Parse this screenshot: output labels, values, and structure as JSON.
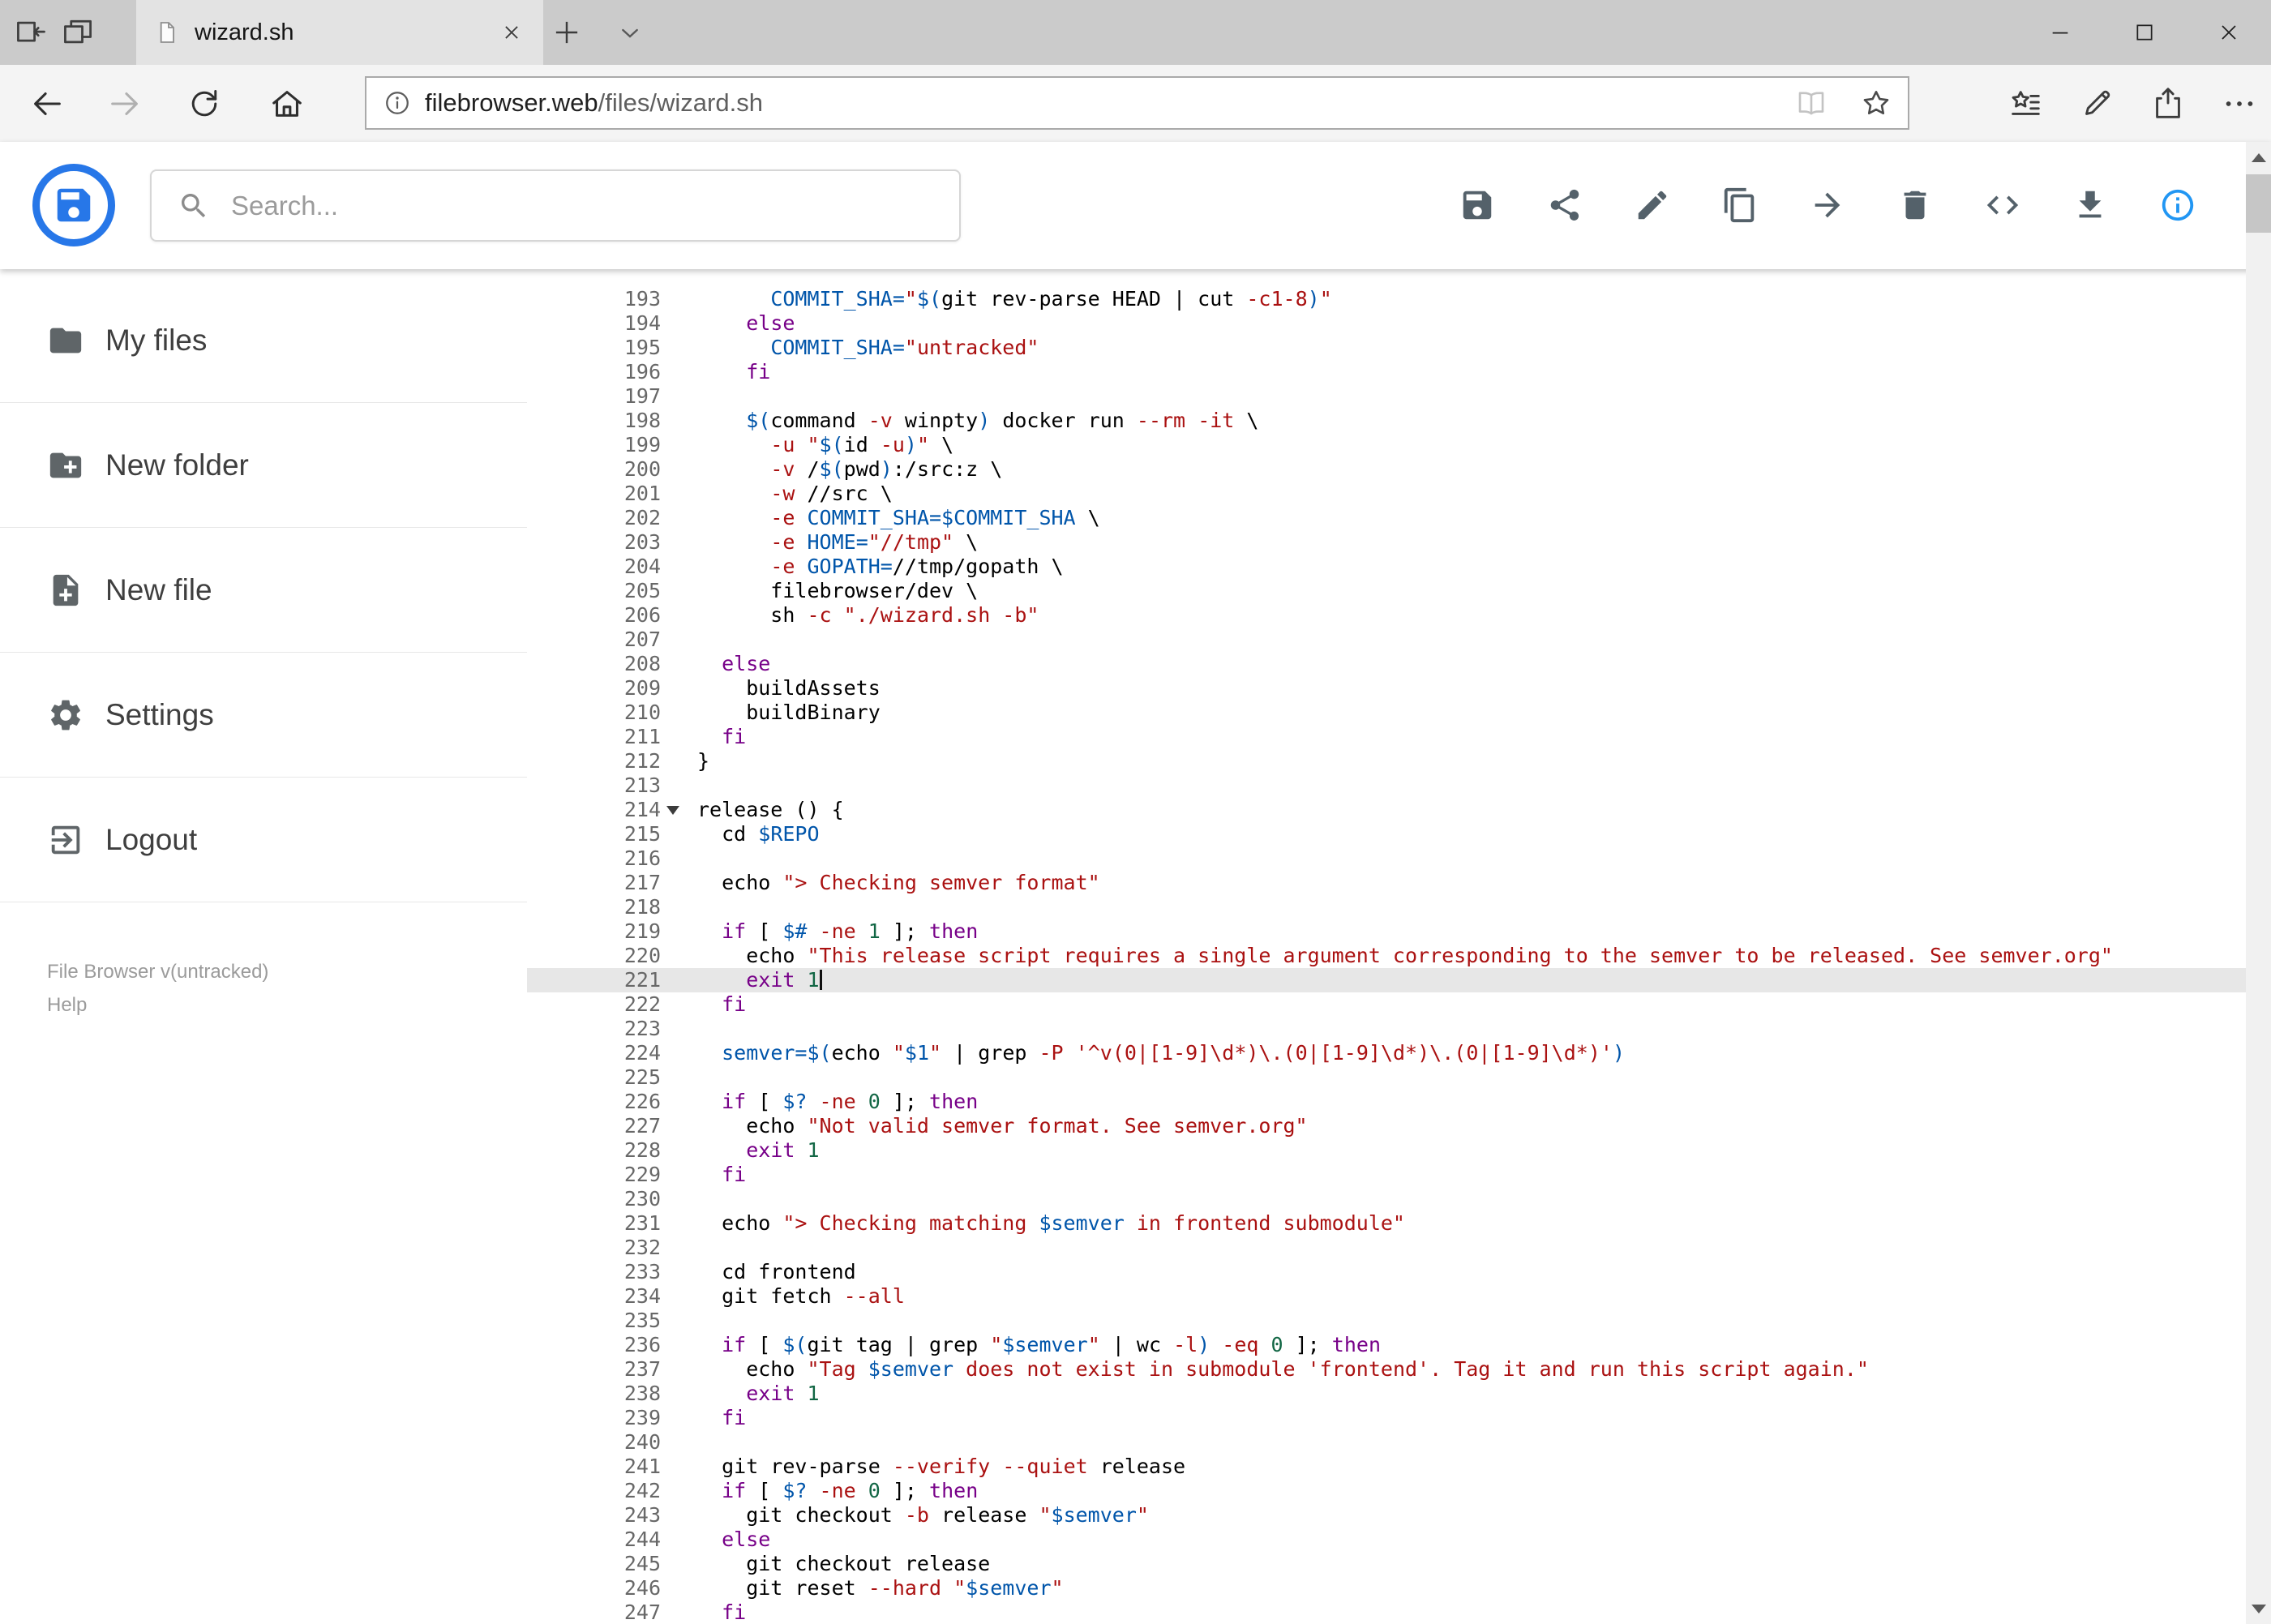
{
  "browser": {
    "tab": {
      "title": "wizard.sh"
    },
    "address": {
      "host": "filebrowser.web",
      "path": "/files/wizard.sh"
    },
    "icons": {
      "tab_strip": [
        "tabs-aside-icon",
        "tab-preview-icon",
        "page-icon",
        "close-tab-icon",
        "new-tab-icon",
        "tab-list-icon"
      ],
      "window_controls": [
        "minimize-icon",
        "maximize-icon",
        "close-window-icon"
      ],
      "navigation": [
        "back-icon",
        "forward-icon",
        "refresh-icon",
        "home-icon"
      ],
      "address_bar": [
        "page-info-icon",
        "reading-view-icon",
        "favorite-star-icon"
      ],
      "actions": [
        "hub-icon",
        "web-note-icon",
        "share-icon",
        "more-icon"
      ]
    }
  },
  "app": {
    "brand_color": "#2777e8",
    "search": {
      "placeholder": "Search..."
    },
    "toolbar_icons": [
      {
        "name": "save-icon",
        "color": "#54616a"
      },
      {
        "name": "share-icon",
        "color": "#54616a"
      },
      {
        "name": "rename-icon",
        "color": "#54616a"
      },
      {
        "name": "copy-icon",
        "color": "#54616a"
      },
      {
        "name": "move-icon",
        "color": "#54616a"
      },
      {
        "name": "delete-icon",
        "color": "#54616a"
      },
      {
        "name": "code-icon",
        "color": "#54616a"
      },
      {
        "name": "download-icon",
        "color": "#54616a"
      },
      {
        "name": "info-icon",
        "color": "#2196f3"
      }
    ],
    "sidebar": {
      "items": [
        {
          "label": "My files",
          "icon": "folder-icon"
        },
        {
          "label": "New folder",
          "icon": "new-folder-icon"
        },
        {
          "label": "New file",
          "icon": "new-file-icon"
        },
        {
          "label": "Settings",
          "icon": "settings-icon"
        },
        {
          "label": "Logout",
          "icon": "logout-icon"
        }
      ],
      "footer": {
        "version": "File Browser v(untracked)",
        "help": "Help"
      }
    }
  },
  "editor": {
    "first_line": 193,
    "last_line": 247,
    "active_line": 221,
    "cursor_line": 221,
    "fold_marker_line": 214,
    "syntax_colors": {
      "plain": "#000000",
      "keyword": "#770088",
      "string": "#aa1111",
      "variable": "#0055aa",
      "number": "#116644",
      "flag": "#aa1111"
    },
    "lines": [
      {
        "n": 193,
        "t": [
          [
            "t",
            "      "
          ],
          [
            "v",
            "COMMIT_SHA="
          ],
          [
            "s",
            "\""
          ],
          [
            "v",
            "$("
          ],
          [
            "t",
            "git rev-parse HEAD | cut "
          ],
          [
            "a",
            "-c1-8"
          ],
          [
            "v",
            ")"
          ],
          [
            "s",
            "\""
          ]
        ]
      },
      {
        "n": 194,
        "t": [
          [
            "t",
            "    "
          ],
          [
            "k",
            "else"
          ]
        ]
      },
      {
        "n": 195,
        "t": [
          [
            "t",
            "      "
          ],
          [
            "v",
            "COMMIT_SHA="
          ],
          [
            "s",
            "\"untracked\""
          ]
        ]
      },
      {
        "n": 196,
        "t": [
          [
            "t",
            "    "
          ],
          [
            "k",
            "fi"
          ]
        ]
      },
      {
        "n": 197,
        "t": []
      },
      {
        "n": 198,
        "t": [
          [
            "t",
            "    "
          ],
          [
            "v",
            "$("
          ],
          [
            "t",
            "command "
          ],
          [
            "a",
            "-v"
          ],
          [
            "t",
            " winpty"
          ],
          [
            "v",
            ")"
          ],
          [
            "t",
            " docker run "
          ],
          [
            "a",
            "--rm"
          ],
          [
            "t",
            " "
          ],
          [
            "a",
            "-it"
          ],
          [
            "t",
            " \\"
          ]
        ]
      },
      {
        "n": 199,
        "t": [
          [
            "t",
            "      "
          ],
          [
            "a",
            "-u"
          ],
          [
            "t",
            " "
          ],
          [
            "s",
            "\""
          ],
          [
            "v",
            "$("
          ],
          [
            "t",
            "id "
          ],
          [
            "a",
            "-u"
          ],
          [
            "v",
            ")"
          ],
          [
            "s",
            "\""
          ],
          [
            "t",
            " \\"
          ]
        ]
      },
      {
        "n": 200,
        "t": [
          [
            "t",
            "      "
          ],
          [
            "a",
            "-v"
          ],
          [
            "t",
            " /"
          ],
          [
            "v",
            "$("
          ],
          [
            "t",
            "pwd"
          ],
          [
            "v",
            ")"
          ],
          [
            "t",
            ":/src:z \\"
          ]
        ]
      },
      {
        "n": 201,
        "t": [
          [
            "t",
            "      "
          ],
          [
            "a",
            "-w"
          ],
          [
            "t",
            " //src \\"
          ]
        ]
      },
      {
        "n": 202,
        "t": [
          [
            "t",
            "      "
          ],
          [
            "a",
            "-e"
          ],
          [
            "t",
            " "
          ],
          [
            "v",
            "COMMIT_SHA=$COMMIT_SHA"
          ],
          [
            "t",
            " \\"
          ]
        ]
      },
      {
        "n": 203,
        "t": [
          [
            "t",
            "      "
          ],
          [
            "a",
            "-e"
          ],
          [
            "t",
            " "
          ],
          [
            "v",
            "HOME="
          ],
          [
            "s",
            "\"//tmp\""
          ],
          [
            "t",
            " \\"
          ]
        ]
      },
      {
        "n": 204,
        "t": [
          [
            "t",
            "      "
          ],
          [
            "a",
            "-e"
          ],
          [
            "t",
            " "
          ],
          [
            "v",
            "GOPATH="
          ],
          [
            "t",
            "//tmp/gopath \\"
          ]
        ]
      },
      {
        "n": 205,
        "t": [
          [
            "t",
            "      filebrowser/dev \\"
          ]
        ]
      },
      {
        "n": 206,
        "t": [
          [
            "t",
            "      sh "
          ],
          [
            "a",
            "-c"
          ],
          [
            "t",
            " "
          ],
          [
            "s",
            "\"./wizard.sh -b\""
          ]
        ]
      },
      {
        "n": 207,
        "t": []
      },
      {
        "n": 208,
        "t": [
          [
            "t",
            "  "
          ],
          [
            "k",
            "else"
          ]
        ]
      },
      {
        "n": 209,
        "t": [
          [
            "t",
            "    buildAssets"
          ]
        ]
      },
      {
        "n": 210,
        "t": [
          [
            "t",
            "    buildBinary"
          ]
        ]
      },
      {
        "n": 211,
        "t": [
          [
            "t",
            "  "
          ],
          [
            "k",
            "fi"
          ]
        ]
      },
      {
        "n": 212,
        "t": [
          [
            "t",
            "}"
          ]
        ]
      },
      {
        "n": 213,
        "t": []
      },
      {
        "n": 214,
        "t": [
          [
            "t",
            "release () {"
          ]
        ]
      },
      {
        "n": 215,
        "t": [
          [
            "t",
            "  cd "
          ],
          [
            "v",
            "$REPO"
          ]
        ]
      },
      {
        "n": 216,
        "t": []
      },
      {
        "n": 217,
        "t": [
          [
            "t",
            "  echo "
          ],
          [
            "s",
            "\"> Checking semver format\""
          ]
        ]
      },
      {
        "n": 218,
        "t": []
      },
      {
        "n": 219,
        "t": [
          [
            "t",
            "  "
          ],
          [
            "k",
            "if"
          ],
          [
            "t",
            " [ "
          ],
          [
            "v",
            "$#"
          ],
          [
            "t",
            " "
          ],
          [
            "a",
            "-ne"
          ],
          [
            "t",
            " "
          ],
          [
            "n",
            "1"
          ],
          [
            "t",
            " ]; "
          ],
          [
            "k",
            "then"
          ]
        ]
      },
      {
        "n": 220,
        "t": [
          [
            "t",
            "    echo "
          ],
          [
            "s",
            "\"This release script requires a single argument corresponding to the semver to be released. See semver.org\""
          ]
        ]
      },
      {
        "n": 221,
        "t": [
          [
            "t",
            "    "
          ],
          [
            "k",
            "exit"
          ],
          [
            "t",
            " "
          ],
          [
            "n",
            "1"
          ]
        ]
      },
      {
        "n": 222,
        "t": [
          [
            "t",
            "  "
          ],
          [
            "k",
            "fi"
          ]
        ]
      },
      {
        "n": 223,
        "t": []
      },
      {
        "n": 224,
        "t": [
          [
            "t",
            "  "
          ],
          [
            "v",
            "semver="
          ],
          [
            "v",
            "$("
          ],
          [
            "t",
            "echo "
          ],
          [
            "s",
            "\""
          ],
          [
            "v",
            "$1"
          ],
          [
            "s",
            "\""
          ],
          [
            "t",
            " | grep "
          ],
          [
            "a",
            "-P"
          ],
          [
            "t",
            " "
          ],
          [
            "s",
            "'^v(0|[1-9]\\d*)\\.(0|[1-9]\\d*)\\.(0|[1-9]\\d*)'"
          ],
          [
            "v",
            ")"
          ]
        ]
      },
      {
        "n": 225,
        "t": []
      },
      {
        "n": 226,
        "t": [
          [
            "t",
            "  "
          ],
          [
            "k",
            "if"
          ],
          [
            "t",
            " [ "
          ],
          [
            "v",
            "$?"
          ],
          [
            "t",
            " "
          ],
          [
            "a",
            "-ne"
          ],
          [
            "t",
            " "
          ],
          [
            "n",
            "0"
          ],
          [
            "t",
            " ]; "
          ],
          [
            "k",
            "then"
          ]
        ]
      },
      {
        "n": 227,
        "t": [
          [
            "t",
            "    echo "
          ],
          [
            "s",
            "\"Not valid semver format. See semver.org\""
          ]
        ]
      },
      {
        "n": 228,
        "t": [
          [
            "t",
            "    "
          ],
          [
            "k",
            "exit"
          ],
          [
            "t",
            " "
          ],
          [
            "n",
            "1"
          ]
        ]
      },
      {
        "n": 229,
        "t": [
          [
            "t",
            "  "
          ],
          [
            "k",
            "fi"
          ]
        ]
      },
      {
        "n": 230,
        "t": []
      },
      {
        "n": 231,
        "t": [
          [
            "t",
            "  echo "
          ],
          [
            "s",
            "\"> Checking matching "
          ],
          [
            "v",
            "$semver"
          ],
          [
            "s",
            " in frontend submodule\""
          ]
        ]
      },
      {
        "n": 232,
        "t": []
      },
      {
        "n": 233,
        "t": [
          [
            "t",
            "  cd frontend"
          ]
        ]
      },
      {
        "n": 234,
        "t": [
          [
            "t",
            "  git fetch "
          ],
          [
            "a",
            "--all"
          ]
        ]
      },
      {
        "n": 235,
        "t": []
      },
      {
        "n": 236,
        "t": [
          [
            "t",
            "  "
          ],
          [
            "k",
            "if"
          ],
          [
            "t",
            " [ "
          ],
          [
            "v",
            "$("
          ],
          [
            "t",
            "git tag | grep "
          ],
          [
            "s",
            "\""
          ],
          [
            "v",
            "$semver"
          ],
          [
            "s",
            "\""
          ],
          [
            "t",
            " | wc "
          ],
          [
            "a",
            "-l"
          ],
          [
            "v",
            ")"
          ],
          [
            "t",
            " "
          ],
          [
            "a",
            "-eq"
          ],
          [
            "t",
            " "
          ],
          [
            "n",
            "0"
          ],
          [
            "t",
            " ]; "
          ],
          [
            "k",
            "then"
          ]
        ]
      },
      {
        "n": 237,
        "t": [
          [
            "t",
            "    echo "
          ],
          [
            "s",
            "\"Tag "
          ],
          [
            "v",
            "$semver"
          ],
          [
            "s",
            " does not exist in submodule 'frontend'. Tag it and run this script again.\""
          ]
        ]
      },
      {
        "n": 238,
        "t": [
          [
            "t",
            "    "
          ],
          [
            "k",
            "exit"
          ],
          [
            "t",
            " "
          ],
          [
            "n",
            "1"
          ]
        ]
      },
      {
        "n": 239,
        "t": [
          [
            "t",
            "  "
          ],
          [
            "k",
            "fi"
          ]
        ]
      },
      {
        "n": 240,
        "t": []
      },
      {
        "n": 241,
        "t": [
          [
            "t",
            "  git rev-parse "
          ],
          [
            "a",
            "--verify"
          ],
          [
            "t",
            " "
          ],
          [
            "a",
            "--quiet"
          ],
          [
            "t",
            " release"
          ]
        ]
      },
      {
        "n": 242,
        "t": [
          [
            "t",
            "  "
          ],
          [
            "k",
            "if"
          ],
          [
            "t",
            " [ "
          ],
          [
            "v",
            "$?"
          ],
          [
            "t",
            " "
          ],
          [
            "a",
            "-ne"
          ],
          [
            "t",
            " "
          ],
          [
            "n",
            "0"
          ],
          [
            "t",
            " ]; "
          ],
          [
            "k",
            "then"
          ]
        ]
      },
      {
        "n": 243,
        "t": [
          [
            "t",
            "    git checkout "
          ],
          [
            "a",
            "-b"
          ],
          [
            "t",
            " release "
          ],
          [
            "s",
            "\""
          ],
          [
            "v",
            "$semver"
          ],
          [
            "s",
            "\""
          ]
        ]
      },
      {
        "n": 244,
        "t": [
          [
            "t",
            "  "
          ],
          [
            "k",
            "else"
          ]
        ]
      },
      {
        "n": 245,
        "t": [
          [
            "t",
            "    git checkout release"
          ]
        ]
      },
      {
        "n": 246,
        "t": [
          [
            "t",
            "    git reset "
          ],
          [
            "a",
            "--hard"
          ],
          [
            "t",
            " "
          ],
          [
            "s",
            "\""
          ],
          [
            "v",
            "$semver"
          ],
          [
            "s",
            "\""
          ]
        ]
      },
      {
        "n": 247,
        "t": [
          [
            "t",
            "  "
          ],
          [
            "k",
            "fi"
          ]
        ]
      }
    ]
  }
}
